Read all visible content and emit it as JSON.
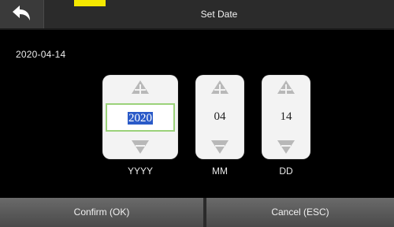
{
  "header": {
    "title": "Set Date",
    "back_icon": "back-arrow-icon"
  },
  "current_date": "2020-04-14",
  "spinners": {
    "year": {
      "value": "2020",
      "label": "YYYY"
    },
    "month": {
      "value": "04",
      "label": "MM"
    },
    "day": {
      "value": "14",
      "label": "DD"
    }
  },
  "footer": {
    "confirm_label": "Confirm (OK)",
    "cancel_label": "Cancel (ESC)"
  },
  "colors": {
    "background": "#000000",
    "header": "#2b2b2b",
    "spinner_bg": "#f3f3f3",
    "selection": "#2a5ac8",
    "focus_border": "#9bd27a",
    "footer_button": "#5a5a5a",
    "accent_yellow": "#f5e800"
  }
}
